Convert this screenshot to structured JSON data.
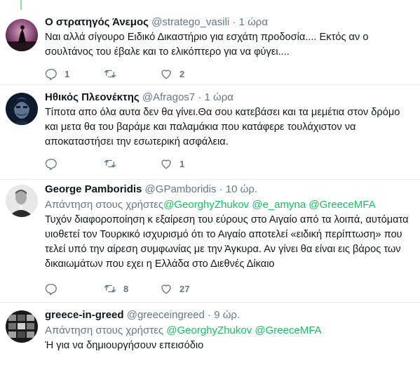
{
  "tweets": [
    {
      "name": "Ο στρατηγός Άνεμος",
      "handle": "@stratego_vasili",
      "dot": "·",
      "time": "1 ώρα",
      "text": "Ναι αλλά σίγουρο Ειδικό Δικαστήριο για εσχάτη προδοσία.... Εκτός αν ο σουλτάνος του έβαλε και το ελικόπτερο για να φύγει....",
      "replies": "1",
      "retweets": "",
      "likes": "2"
    },
    {
      "name": "Ηθικός Πλεονέκτης",
      "handle": "@Afragos7",
      "dot": "·",
      "time": "1 ώρα",
      "text": "Τίποτα απο όλα αυτα δεν θα γίνει.Θα σου κατεβάσει και τα μεμέτια στον δρόμο και μετα θα του βαράμε και παλαμάκια που κατάφερε τουλάχιστον να αποκαταστήσει την εσωτερική ασφάλεια.",
      "replies": "",
      "retweets": "",
      "likes": "1"
    },
    {
      "name": "George Pamboridis",
      "handle": "@GPamboridis",
      "dot": "·",
      "time": "10 ώρ.",
      "replying_prefix": "Απάντηση στους χρήστες",
      "mentions": [
        "@GeorghyZhukov",
        "@e_amyna",
        "@GreeceMFA"
      ],
      "text": "Τυχόν διαφοροποίηση κ εξαίρεση του εύρους στο Αιγαίο από τα λοιπά, αυτόματα υιοθετεί τον Τουρκικό ισχυρισμό ότι το Αιγαίο αποτελεί «ειδική περίπτωση» που τελεί υπό την αίρεση συμφωνίας με την Άγκυρα. Αν γίνει θα είναι εις βάρος των δικαιωμάτων που εχει η Ελλάδα στο Διεθνές Δίκαιο",
      "replies": "",
      "retweets": "8",
      "likes": "27"
    },
    {
      "name": "greece-in-greed",
      "handle": "@greeceingreed",
      "dot": "·",
      "time": "9 ώρ.",
      "replying_prefix": "Απάντηση στους χρήστες",
      "mentions": [
        "@GeorghyZhukov",
        "@GreeceMFA"
      ],
      "text": "Ή για να δημιουργήσουν επεισόδιο"
    }
  ],
  "icons": {
    "reply": "reply-icon",
    "retweet": "retweet-icon",
    "like": "heart-icon"
  },
  "colors": {
    "mention": "#17bf63",
    "secondary_text": "#657786",
    "divider": "#e6ecf0",
    "thread_line": "#8fdcb0"
  }
}
